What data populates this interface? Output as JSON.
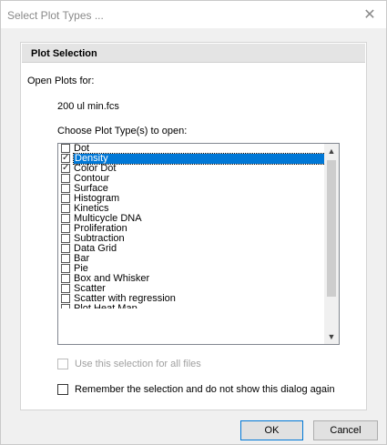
{
  "window": {
    "title": "Select Plot Types ...",
    "close_icon": "close-icon"
  },
  "panel": {
    "header": "Plot Selection",
    "open_plots_label": "Open Plots for:",
    "file_name": "200 ul min.fcs",
    "choose_label": "Choose Plot Type(s) to open:"
  },
  "plot_types": [
    {
      "label": "Dot",
      "checked": false,
      "selected": false
    },
    {
      "label": "Density",
      "checked": true,
      "selected": true
    },
    {
      "label": "Color Dot",
      "checked": true,
      "selected": false
    },
    {
      "label": "Contour",
      "checked": false,
      "selected": false
    },
    {
      "label": "Surface",
      "checked": false,
      "selected": false
    },
    {
      "label": "Histogram",
      "checked": false,
      "selected": false
    },
    {
      "label": "Kinetics",
      "checked": false,
      "selected": false
    },
    {
      "label": "Multicycle DNA",
      "checked": false,
      "selected": false
    },
    {
      "label": "Proliferation",
      "checked": false,
      "selected": false
    },
    {
      "label": "Subtraction",
      "checked": false,
      "selected": false
    },
    {
      "label": "Data Grid",
      "checked": false,
      "selected": false
    },
    {
      "label": "Bar",
      "checked": false,
      "selected": false
    },
    {
      "label": "Pie",
      "checked": false,
      "selected": false
    },
    {
      "label": "Box and Whisker",
      "checked": false,
      "selected": false
    },
    {
      "label": "Scatter",
      "checked": false,
      "selected": false
    },
    {
      "label": "Scatter with regression",
      "checked": false,
      "selected": false
    },
    {
      "label": "Plot Heat Map",
      "checked": false,
      "selected": false
    }
  ],
  "options": {
    "all_files": {
      "label": "Use this selection for all files",
      "checked": false,
      "enabled": false
    },
    "remember": {
      "label": "Remember the selection and do not show this dialog again",
      "checked": false,
      "enabled": true
    }
  },
  "buttons": {
    "ok": "OK",
    "cancel": "Cancel"
  },
  "colors": {
    "selection": "#0078d7",
    "panel_header": "#e4e4e4",
    "dialog_bg": "#f0f0f0"
  }
}
